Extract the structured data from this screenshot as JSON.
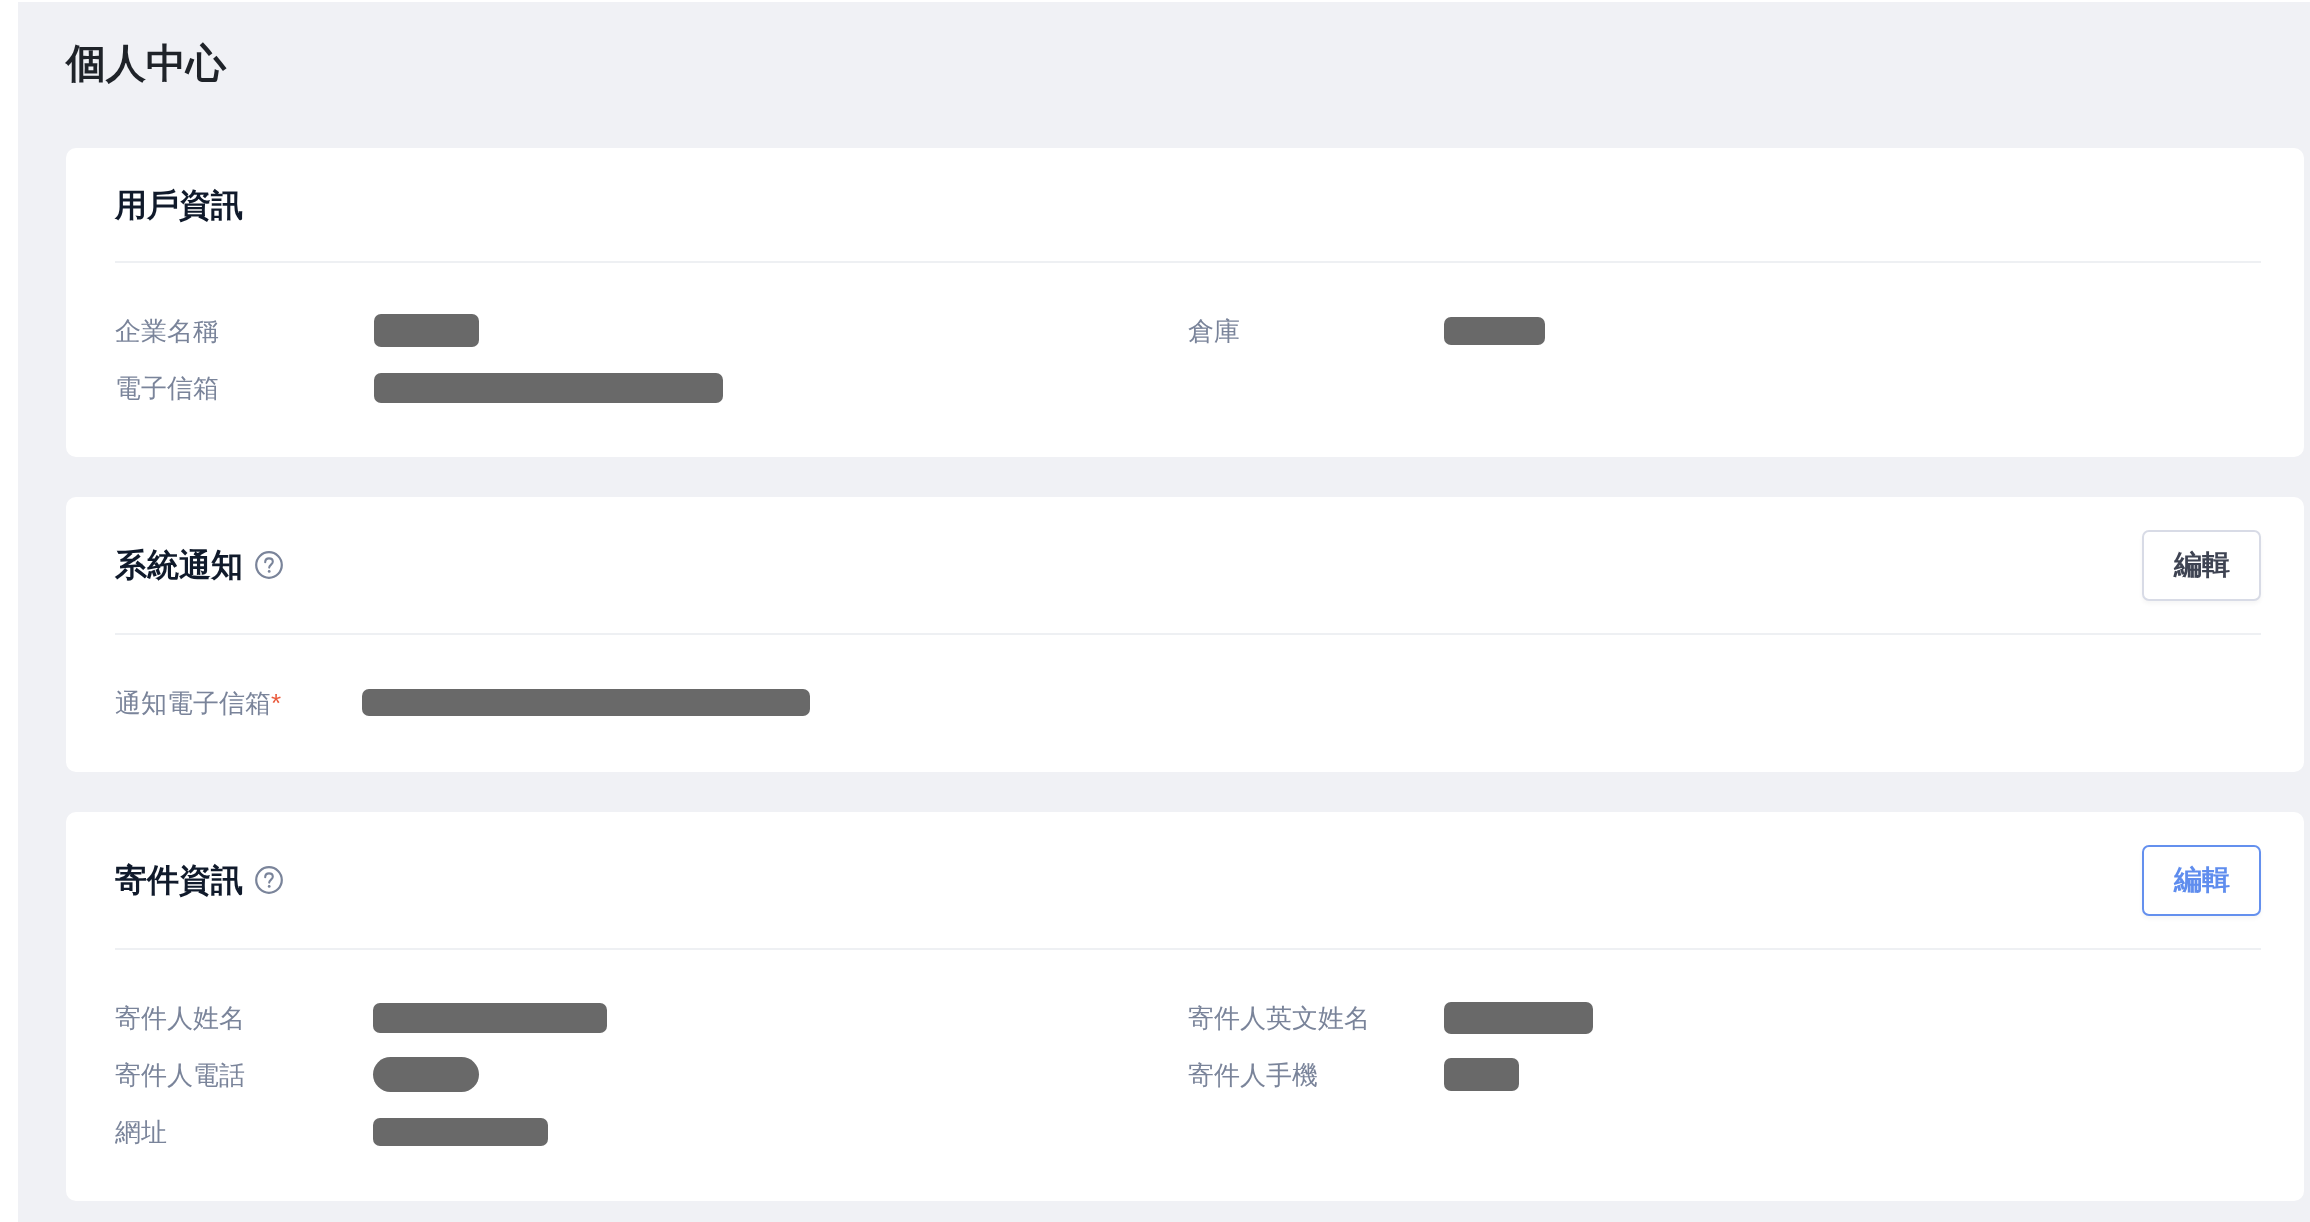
{
  "page": {
    "title": "個人中心"
  },
  "cards": [
    {
      "title": "用戶資訊",
      "help": false,
      "columns": [
        {
          "fields": [
            {
              "label": "企業名稱",
              "redacted": true
            },
            {
              "label": "電子信箱",
              "redacted": true
            }
          ]
        },
        {
          "fields": [
            {
              "label": "倉庫",
              "redacted": true
            }
          ]
        }
      ]
    },
    {
      "title": "系統通知",
      "help": true,
      "edit_button": {
        "label": "編輯",
        "focused": false
      },
      "columns": [
        {
          "fields": [
            {
              "label": "通知電子信箱",
              "required_mark": "*",
              "redacted": true
            }
          ]
        }
      ]
    },
    {
      "title": "寄件資訊",
      "help": true,
      "edit_button": {
        "label": "編輯",
        "focused": true
      },
      "columns": [
        {
          "fields": [
            {
              "label": "寄件人姓名",
              "redacted": true
            },
            {
              "label": "寄件人電話",
              "redacted": true
            },
            {
              "label": "網址",
              "redacted": true
            }
          ]
        },
        {
          "fields": [
            {
              "label": "寄件人英文姓名",
              "redacted": true
            },
            {
              "label": "寄件人手機",
              "redacted": true
            }
          ]
        }
      ]
    }
  ]
}
